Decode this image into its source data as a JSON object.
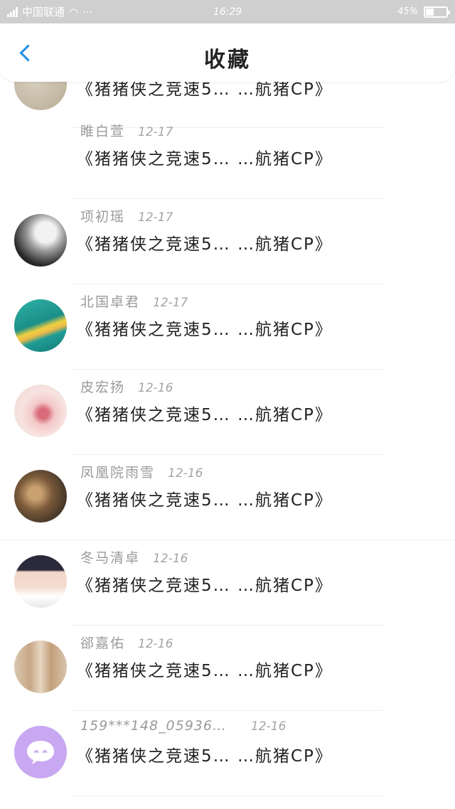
{
  "status_bar": {
    "carrier": "中国联通",
    "dots": "···",
    "time": "16:29",
    "battery": "45%",
    "battery_level": 0.45
  },
  "header": {
    "title": "收藏"
  },
  "items": [
    {
      "name": "",
      "date": "",
      "title": "《猪猪侠之竞速5… …航猪CP》",
      "avatar": "sand"
    },
    {
      "name": "睢白萱",
      "date": "12-17",
      "title": "《猪猪侠之竞速5… …航猪CP》",
      "avatar": "none"
    },
    {
      "name": "项初瑶",
      "date": "12-17",
      "title": "《猪猪侠之竞速5… …航猪CP》",
      "avatar": "mono"
    },
    {
      "name": "北国卓君",
      "date": "12-17",
      "title": "《猪猪侠之竞速5… …航猪CP》",
      "avatar": "teal"
    },
    {
      "name": "皮宏扬",
      "date": "12-16",
      "title": "《猪猪侠之竞速5… …航猪CP》",
      "avatar": "flowers"
    },
    {
      "name": "凤凰院雨雪",
      "date": "12-16",
      "title": "《猪猪侠之竞速5… …航猪CP》",
      "avatar": "brown"
    },
    {
      "name": "冬马清卓",
      "date": "12-16",
      "title": "《猪猪侠之竞速5… …航猪CP》",
      "avatar": "girl"
    },
    {
      "name": "郤嘉佑",
      "date": "12-16",
      "title": "《猪猪侠之竞速5… …航猪CP》",
      "avatar": "blond"
    },
    {
      "name": "159***148_05936…",
      "date": "12-16",
      "title": "《猪猪侠之竞速5… …航猪CP》",
      "avatar": "chat"
    }
  ],
  "colors": {
    "accent": "#1e90e6",
    "chat_avatar": "#c9a8f2"
  }
}
